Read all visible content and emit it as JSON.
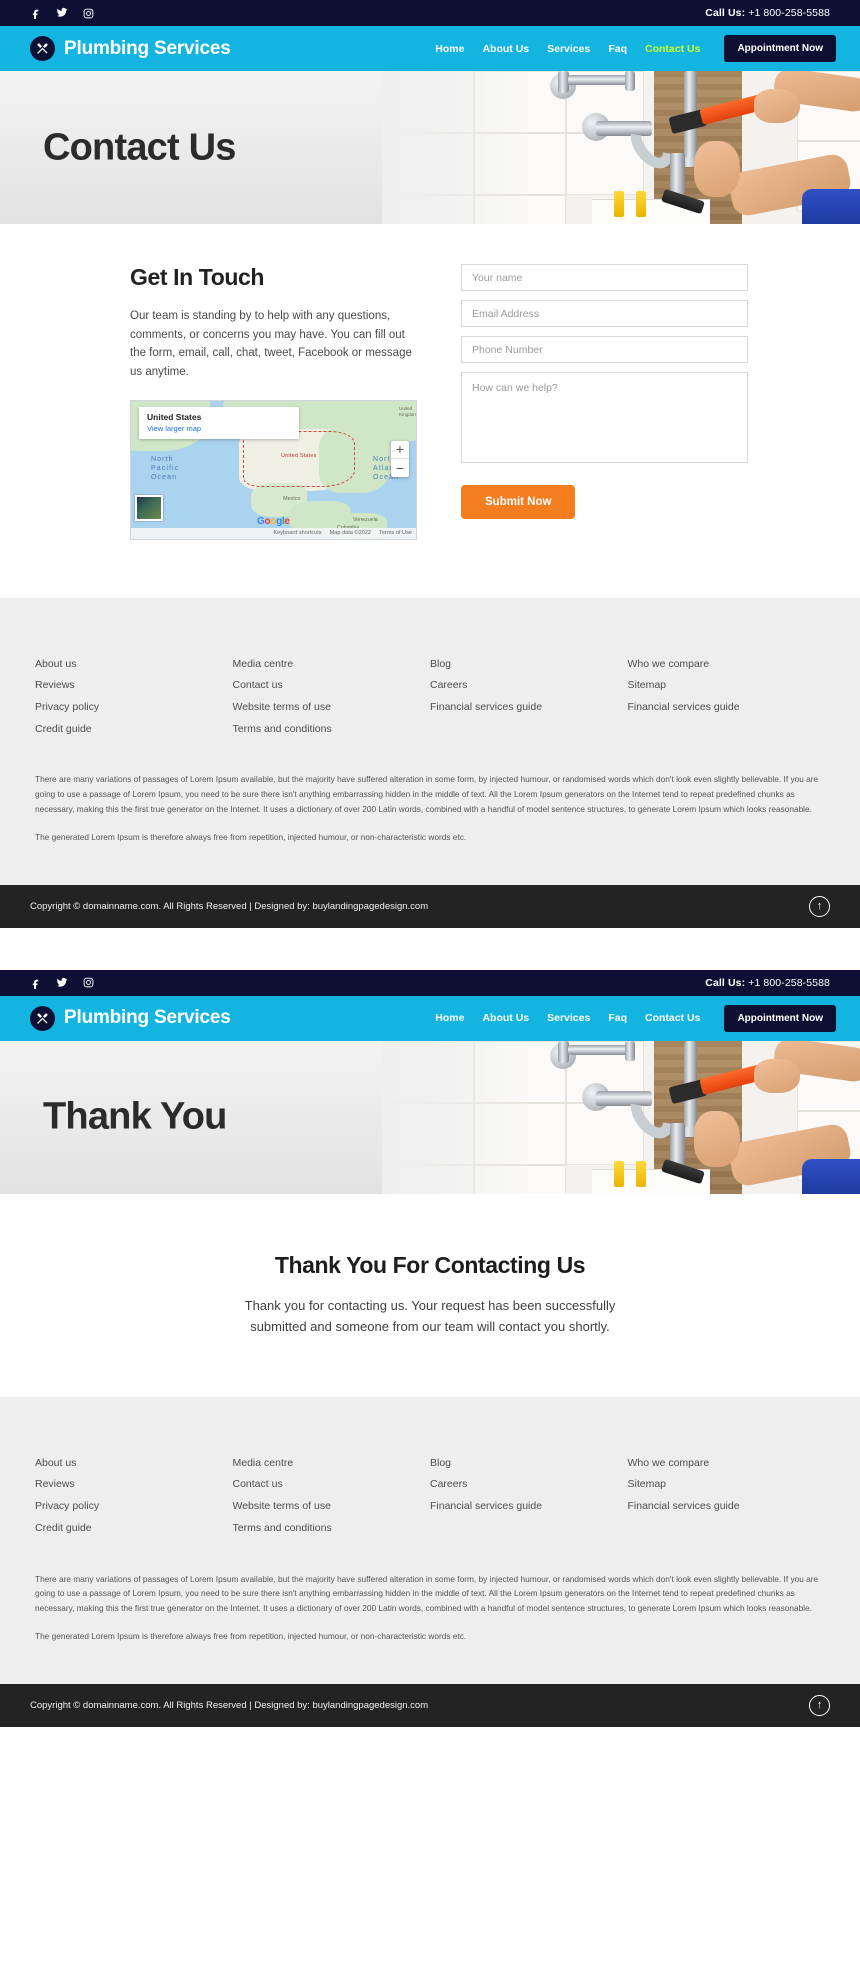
{
  "topbar": {
    "social": [
      {
        "name": "facebook-icon",
        "label": "f"
      },
      {
        "name": "twitter-icon",
        "label": "t"
      },
      {
        "name": "instagram-icon",
        "label": "ig"
      }
    ],
    "call_label": "Call Us:",
    "phone": "+1 800-258-5588"
  },
  "nav": {
    "brand": "Plumbing Services",
    "brand_icon": "wrench-cross-icon",
    "links": [
      {
        "label": "Home",
        "active": false
      },
      {
        "label": "About Us",
        "active": false
      },
      {
        "label": "Services",
        "active": false
      },
      {
        "label": "Faq",
        "active": false
      },
      {
        "label": "Contact Us",
        "active": true
      }
    ],
    "cta": "Appointment Now",
    "accent": "#13b5e0",
    "active_color": "#caff2e",
    "dark": "#0d1033"
  },
  "hero": {
    "title": "Contact Us"
  },
  "contact": {
    "title": "Get In Touch",
    "copy": "Our team is standing by to help with any questions, comments, or concerns you may have. You can fill out the form, email, call, chat, tweet, Facebook or message us anytime.",
    "map": {
      "card_title": "United States",
      "card_link": "View larger map",
      "labels": [
        "North Pacific Ocean",
        "North Atlantic Ocean"
      ],
      "place_labels": [
        "United States",
        "Mexico",
        "Venezuela",
        "Colombia",
        "United Kingdom"
      ],
      "brand": "Google",
      "keyboard_shortcuts": "Keyboard shortcuts",
      "map_data": "Map data ©2022",
      "terms": "Terms of Use",
      "zoom_in": "+",
      "zoom_out": "−"
    },
    "form": {
      "name_placeholder": "Your name",
      "email_placeholder": "Email Address",
      "phone_placeholder": "Phone Number",
      "message_placeholder": "How can we help?",
      "submit_label": "Submit Now",
      "submit_color": "#f47d20"
    }
  },
  "footer": {
    "columns": [
      {
        "links": [
          "About us",
          "Reviews",
          "Privacy policy",
          "Credit guide"
        ]
      },
      {
        "links": [
          "Media centre",
          "Contact us",
          "Website terms of use",
          "Terms and conditions"
        ]
      },
      {
        "links": [
          "Blog",
          "Careers",
          "Financial services guide"
        ]
      },
      {
        "links": [
          "Who we compare",
          "Sitemap",
          "Financial services guide"
        ]
      }
    ],
    "paragraph_1": "There are many variations of passages of Lorem Ipsum available, but the majority have suffered alteration in some form, by injected humour, or randomised words which don't look even slightly believable. If you are going to use a passage of Lorem Ipsum, you need to be sure there isn't anything embarrassing hidden in the middle of text. All the Lorem Ipsum generators on the Internet tend to repeat predefined chunks as necessary, making this the first true generator on the Internet. It uses a dictionary of over 200 Latin words, combined with a handful of model sentence structures, to generate Lorem Ipsum which looks reasonable.",
    "paragraph_2": "The generated Lorem Ipsum is therefore always free from repetition, injected humour, or non-characteristic words etc.",
    "copyright": "Copyright © domainname.com. All Rights Reserved | Designed by: buylandingpagedesign.com",
    "scroll_top_icon": "arrow-up-circle-icon"
  },
  "page2": {
    "hero_title": "Thank You",
    "title": "Thank You For Contacting Us",
    "copy": "Thank you for contacting us. Your request has been successfully submitted and someone from our team will contact you shortly."
  }
}
